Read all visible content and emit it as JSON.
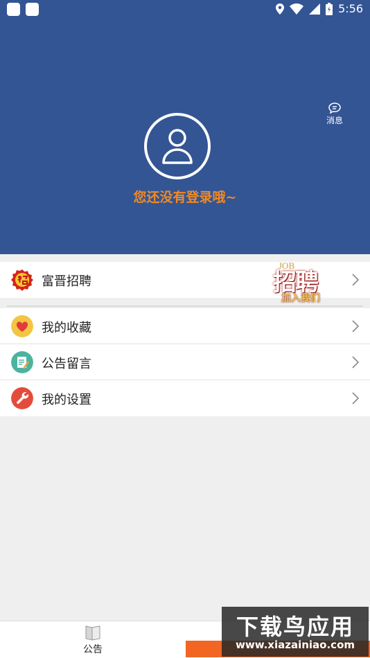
{
  "status_bar": {
    "time": "5:56",
    "icons": [
      "location-icon",
      "wifi-icon",
      "signal-icon",
      "battery-icon"
    ]
  },
  "header": {
    "message_label": "消息",
    "login_prompt": "您还没有登录哦~"
  },
  "promo": {
    "label": "富晋招聘",
    "banner": {
      "job": "JOB",
      "title": "招聘",
      "subtitle": "加入我们"
    }
  },
  "menu": [
    {
      "label": "我的收藏",
      "icon": "heart-icon"
    },
    {
      "label": "公告留言",
      "icon": "note-icon"
    },
    {
      "label": "我的设置",
      "icon": "wrench-icon"
    }
  ],
  "bottom_nav": {
    "tab_label": "公告"
  },
  "watermark": {
    "title": "下载鸟应用",
    "url": "www.xiazainiao.com"
  },
  "colors": {
    "header": "#345594",
    "accent": "#f08a24",
    "tab_active": "#f26522"
  }
}
